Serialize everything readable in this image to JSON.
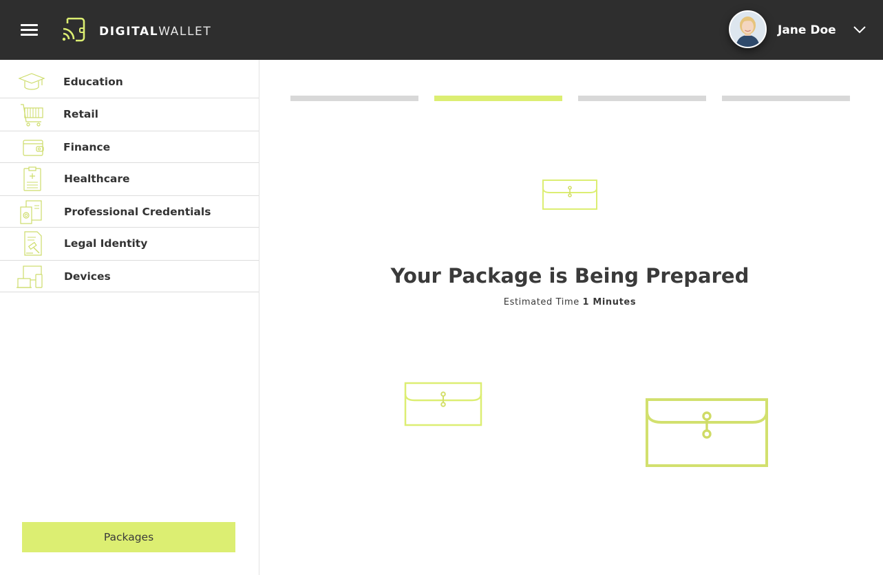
{
  "brand": {
    "name_bold": "DIGITAL",
    "name_light": "WALLET",
    "accent_color": "#dcee72",
    "header_color": "#2e2e2e"
  },
  "header": {
    "menu_icon": "hamburger-menu-icon",
    "user_name": "Jane Doe",
    "dropdown_icon": "chevron-down-icon"
  },
  "sidebar": {
    "items": [
      {
        "label": "Education",
        "icon": "graduation-cap-icon"
      },
      {
        "label": "Retail",
        "icon": "shopping-cart-icon"
      },
      {
        "label": "Finance",
        "icon": "wallet-icon"
      },
      {
        "label": "Healthcare",
        "icon": "medical-clipboard-icon"
      },
      {
        "label": "Professional Credentials",
        "icon": "credential-badge-icon"
      },
      {
        "label": "Legal Identity",
        "icon": "gavel-document-icon"
      },
      {
        "label": "Devices",
        "icon": "devices-icon"
      }
    ],
    "packages_label": "Packages"
  },
  "main": {
    "progress": {
      "total_steps": 4,
      "active_step": 2
    },
    "title": "Your Package is Being Prepared",
    "estimated_label": "Estimated Time",
    "estimated_value": "1 Minutes"
  }
}
